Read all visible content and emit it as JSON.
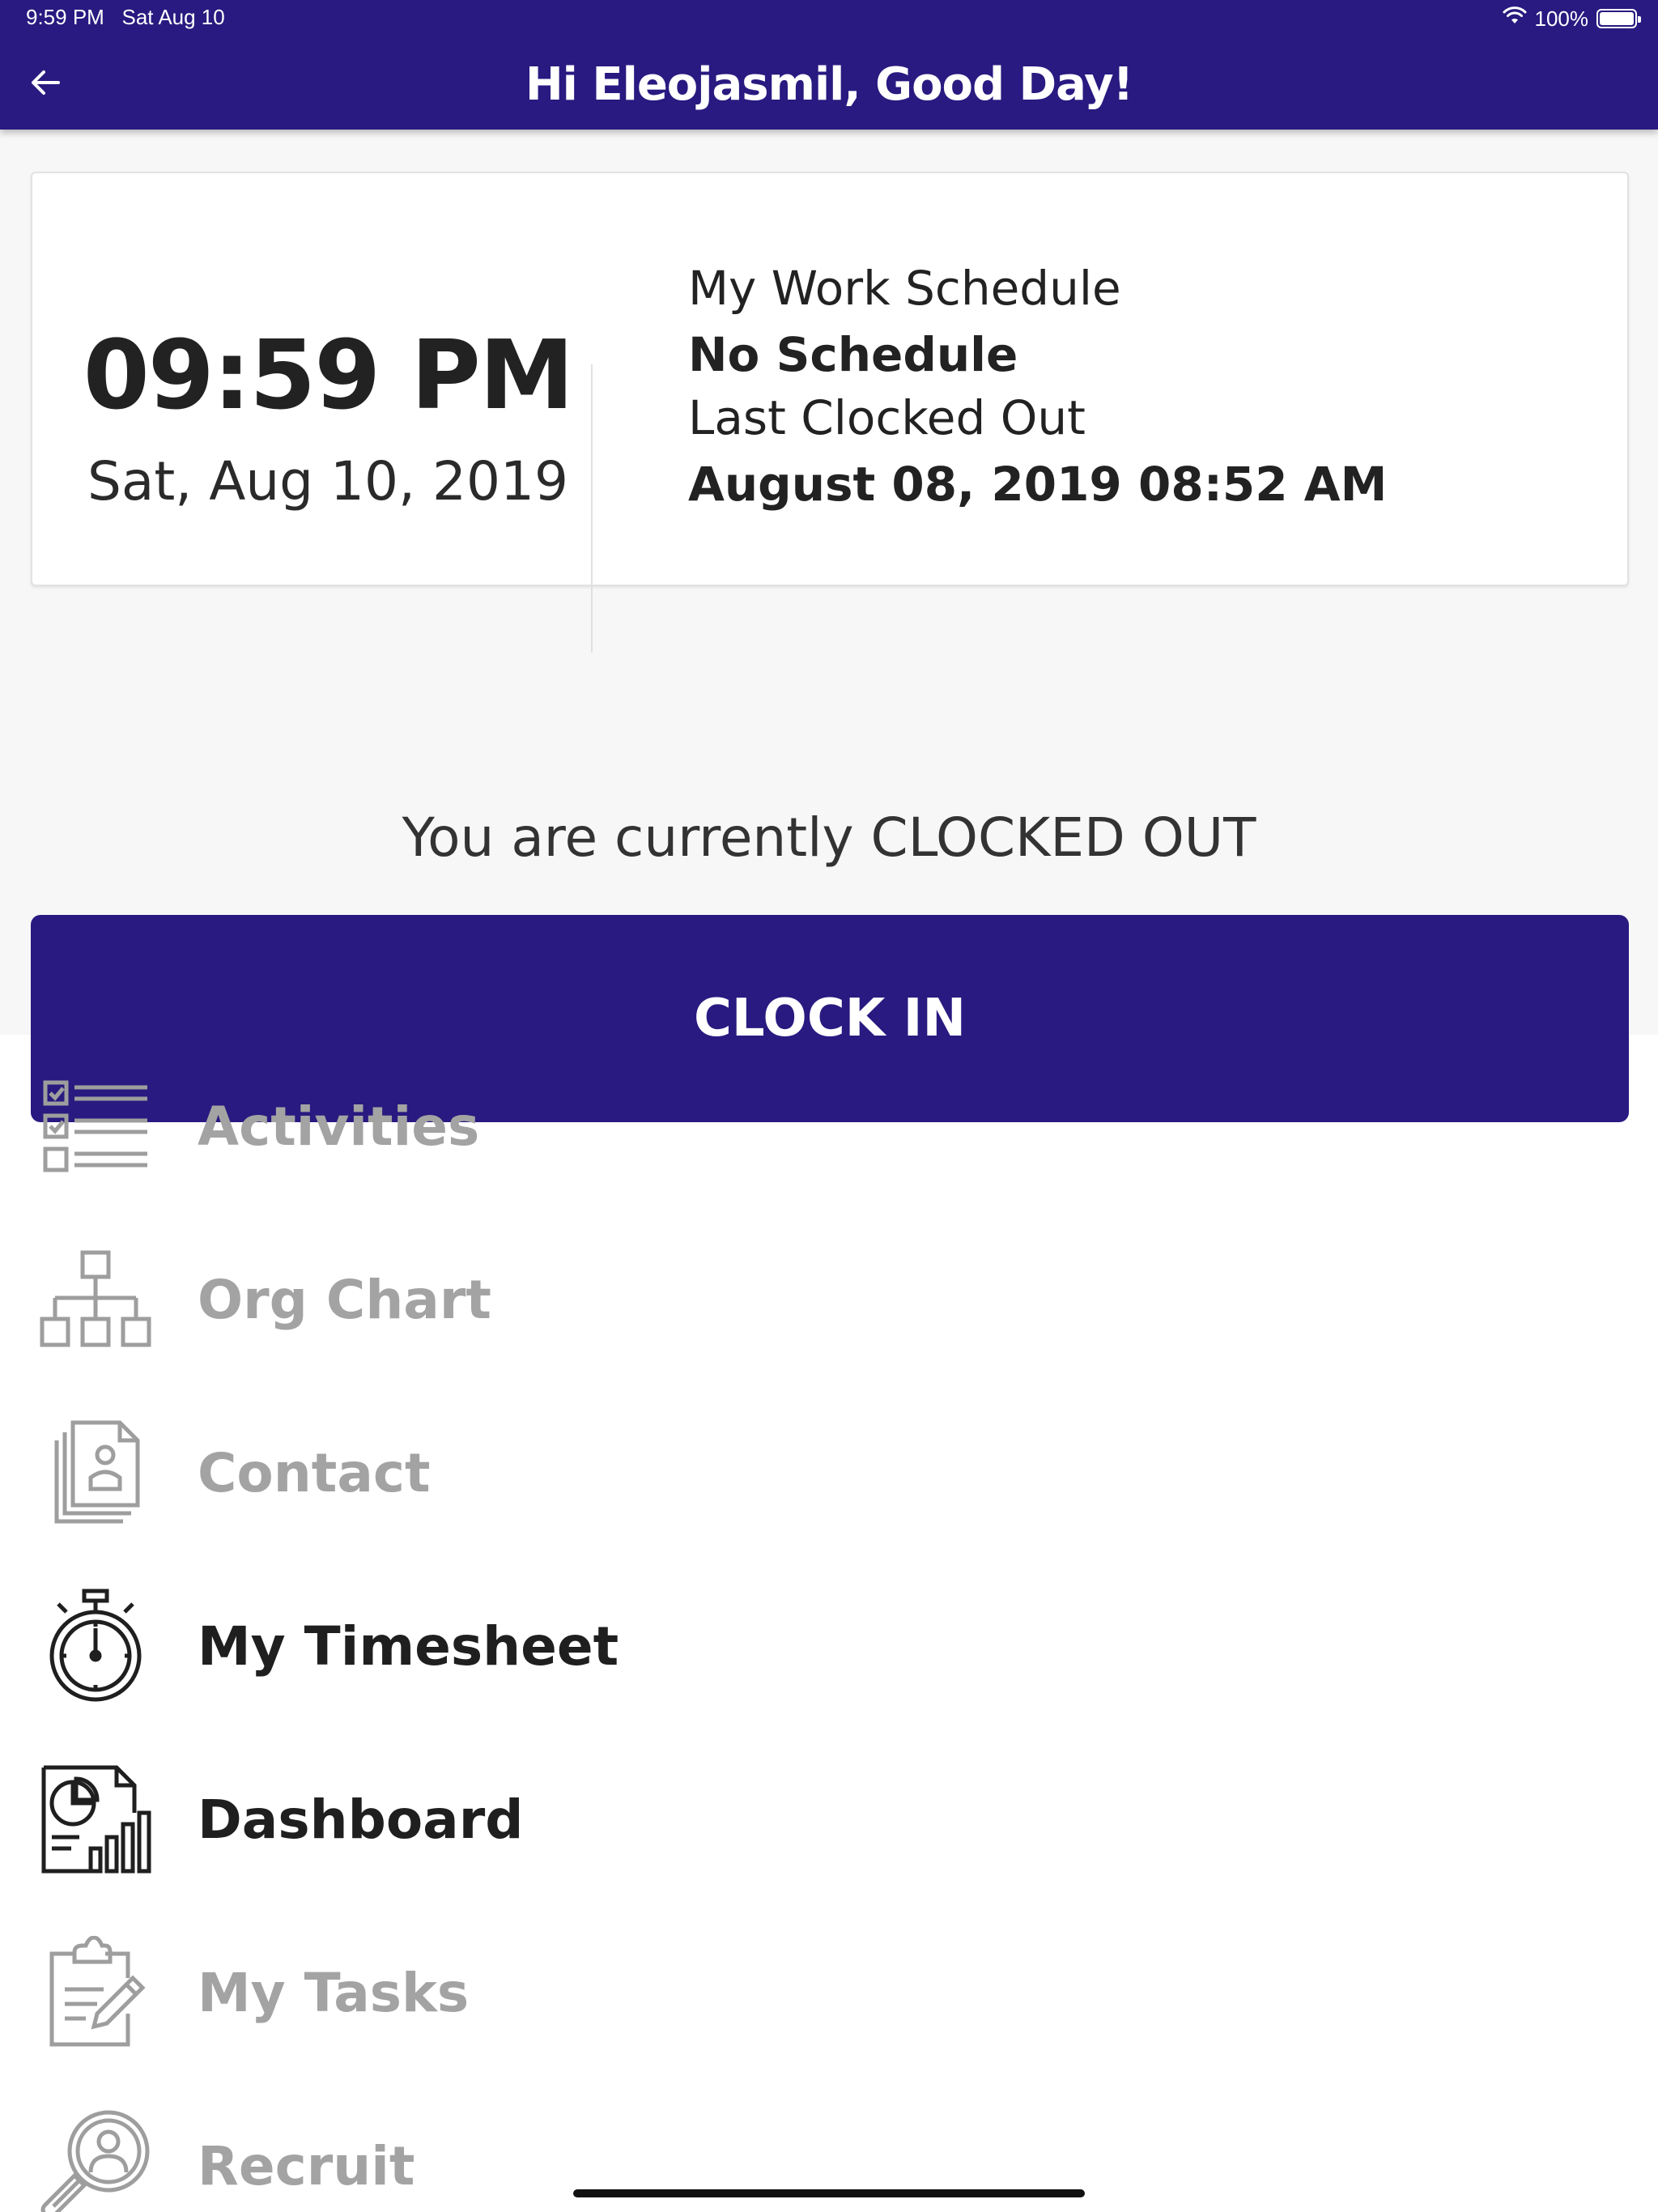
{
  "status_bar": {
    "time": "9:59 PM",
    "date": "Sat Aug 10",
    "battery": "100%"
  },
  "header": {
    "title": "Hi Eleojasmil, Good Day!",
    "back_icon": "arrow-left-icon",
    "background_color": "#281a80"
  },
  "card": {
    "time": "09:59 PM",
    "date": "Sat, Aug 10, 2019",
    "schedule_label": "My Work Schedule",
    "schedule_value": "No Schedule",
    "last_clocked_label": "Last Clocked Out",
    "last_clocked_value": "August 08, 2019 08:52 AM"
  },
  "clock_status": "You are currently CLOCKED OUT",
  "clock_in_button": {
    "label": "CLOCK IN",
    "color": "#281a80"
  },
  "menu": {
    "items": [
      {
        "label": "Activities",
        "icon": "checklist-icon",
        "enabled": false
      },
      {
        "label": "Org Chart",
        "icon": "org-chart-icon",
        "enabled": false
      },
      {
        "label": "Contact",
        "icon": "contact-card-icon",
        "enabled": false
      },
      {
        "label": "My Timesheet",
        "icon": "stopwatch-icon",
        "enabled": true
      },
      {
        "label": "Dashboard",
        "icon": "report-chart-icon",
        "enabled": true
      },
      {
        "label": "My Tasks",
        "icon": "clipboard-pencil-icon",
        "enabled": false
      },
      {
        "label": "Recruit",
        "icon": "magnifier-person-icon",
        "enabled": false
      }
    ],
    "disabled_color": "#a3a3a3",
    "enabled_color": "#1f1f1f"
  }
}
